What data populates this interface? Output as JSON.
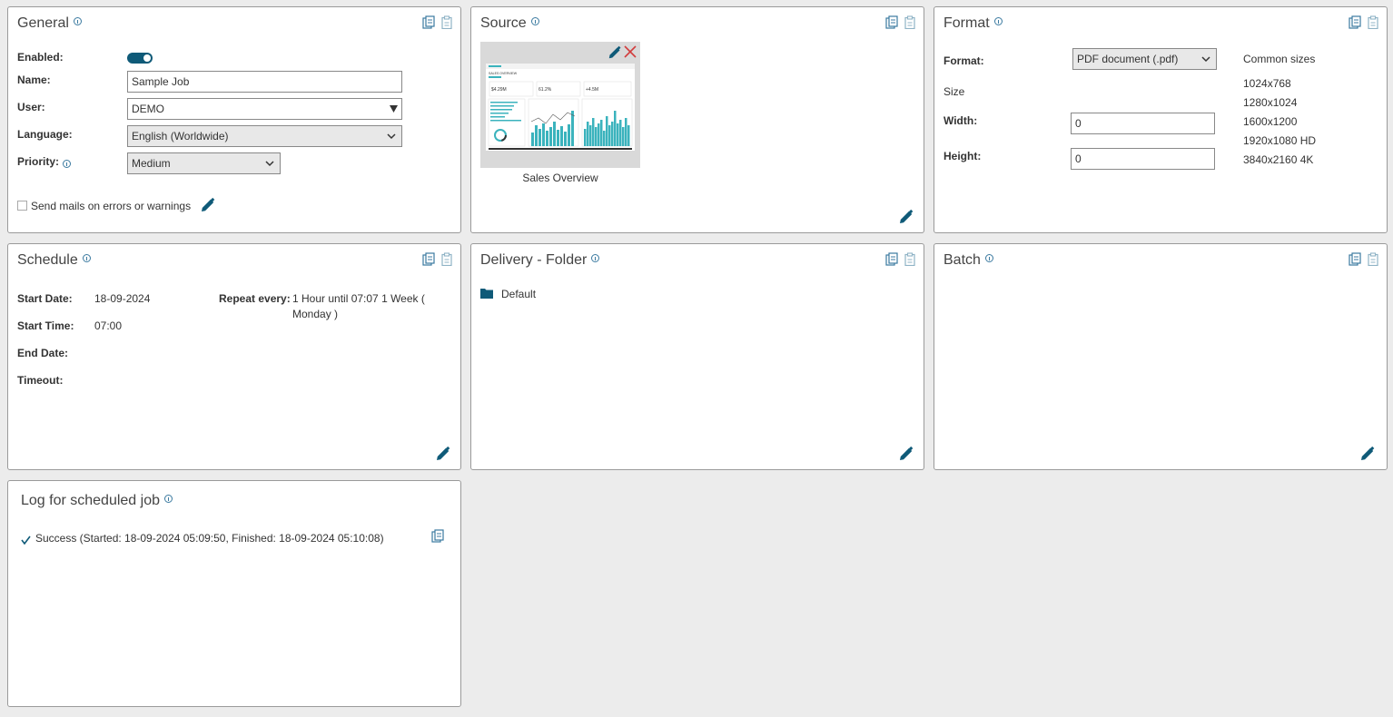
{
  "general": {
    "title": "General",
    "enabled_label": "Enabled:",
    "name_label": "Name:",
    "name_value": "Sample Job",
    "user_label": "User:",
    "user_value": "DEMO",
    "language_label": "Language:",
    "language_value": "English (Worldwide)",
    "priority_label": "Priority:",
    "priority_value": "Medium",
    "send_mails_label": "Send mails on errors or warnings"
  },
  "source": {
    "title": "Source",
    "report_name": "Sales Overview"
  },
  "format": {
    "title": "Format",
    "format_label": "Format:",
    "format_value": "PDF document (.pdf)",
    "size_label": "Size",
    "width_label": "Width:",
    "width_value": "0",
    "height_label": "Height:",
    "height_value": "0",
    "common_sizes_label": "Common sizes",
    "common_sizes": [
      "1024x768",
      "1280x1024",
      "1600x1200",
      "1920x1080 HD",
      "3840x2160 4K"
    ]
  },
  "schedule": {
    "title": "Schedule",
    "start_date_label": "Start Date:",
    "start_date_value": "18-09-2024",
    "start_time_label": "Start Time:",
    "start_time_value": "07:00",
    "end_date_label": "End Date:",
    "timeout_label": "Timeout:",
    "repeat_label": "Repeat every:",
    "repeat_line1": "1 Hour until 07:07 1 Week (",
    "repeat_line2": "Monday )"
  },
  "delivery": {
    "title": "Delivery - Folder",
    "folder": "Default"
  },
  "batch": {
    "title": "Batch"
  },
  "log": {
    "title": "Log for scheduled job",
    "entry": "Success (Started: 18-09-2024 05:09:50, Finished: 18-09-2024 05:10:08)"
  },
  "thumb": {
    "header": "SALES OVERVIEW",
    "kpi1": "$4.29M",
    "kpi2": "61.2%",
    "kpi3": "+4.5M"
  },
  "colors": {
    "accent": "#0f5a78",
    "icon_blue": "#3b7aa0",
    "chart_teal": "#3bb3bd",
    "delete_red": "#d23c3c"
  }
}
